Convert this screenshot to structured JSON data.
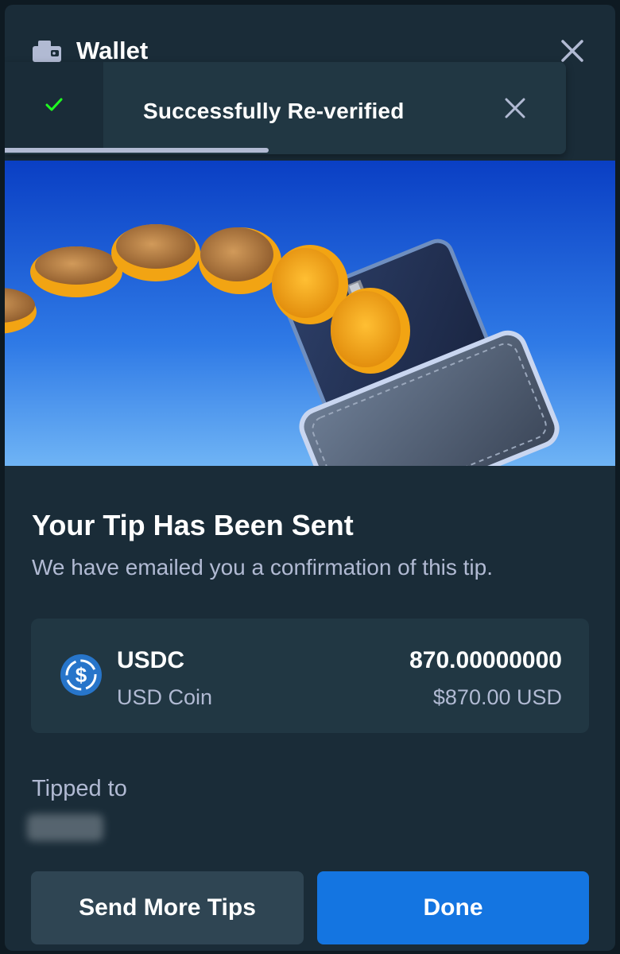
{
  "header": {
    "title": "Wallet",
    "icon": "wallet-icon",
    "close_icon": "close-icon"
  },
  "toast": {
    "message": "Successfully Re-verified",
    "status_icon": "check-icon",
    "status_color": "#1fff20",
    "close_icon": "close-icon",
    "progress": 0.47
  },
  "hero": {
    "image": "coins-flowing-into-wallet-illustration"
  },
  "content": {
    "title": "Your Tip Has Been Sent",
    "subtitle": "We have emailed you a confirmation of this tip."
  },
  "coin": {
    "symbol": "USDC",
    "name": "USD Coin",
    "amount": "870.00000000",
    "fiat_value": "$870.00 USD",
    "icon": "usdc-icon",
    "icon_color": "#2775ca"
  },
  "tipped": {
    "label": "Tipped to"
  },
  "buttons": {
    "secondary": "Send More Tips",
    "primary": "Done"
  },
  "colors": {
    "background": "#1a2c38",
    "card": "#213743",
    "primary_button": "#1475e1",
    "secondary_button": "#2f4553",
    "muted_text": "#b1bad3"
  }
}
